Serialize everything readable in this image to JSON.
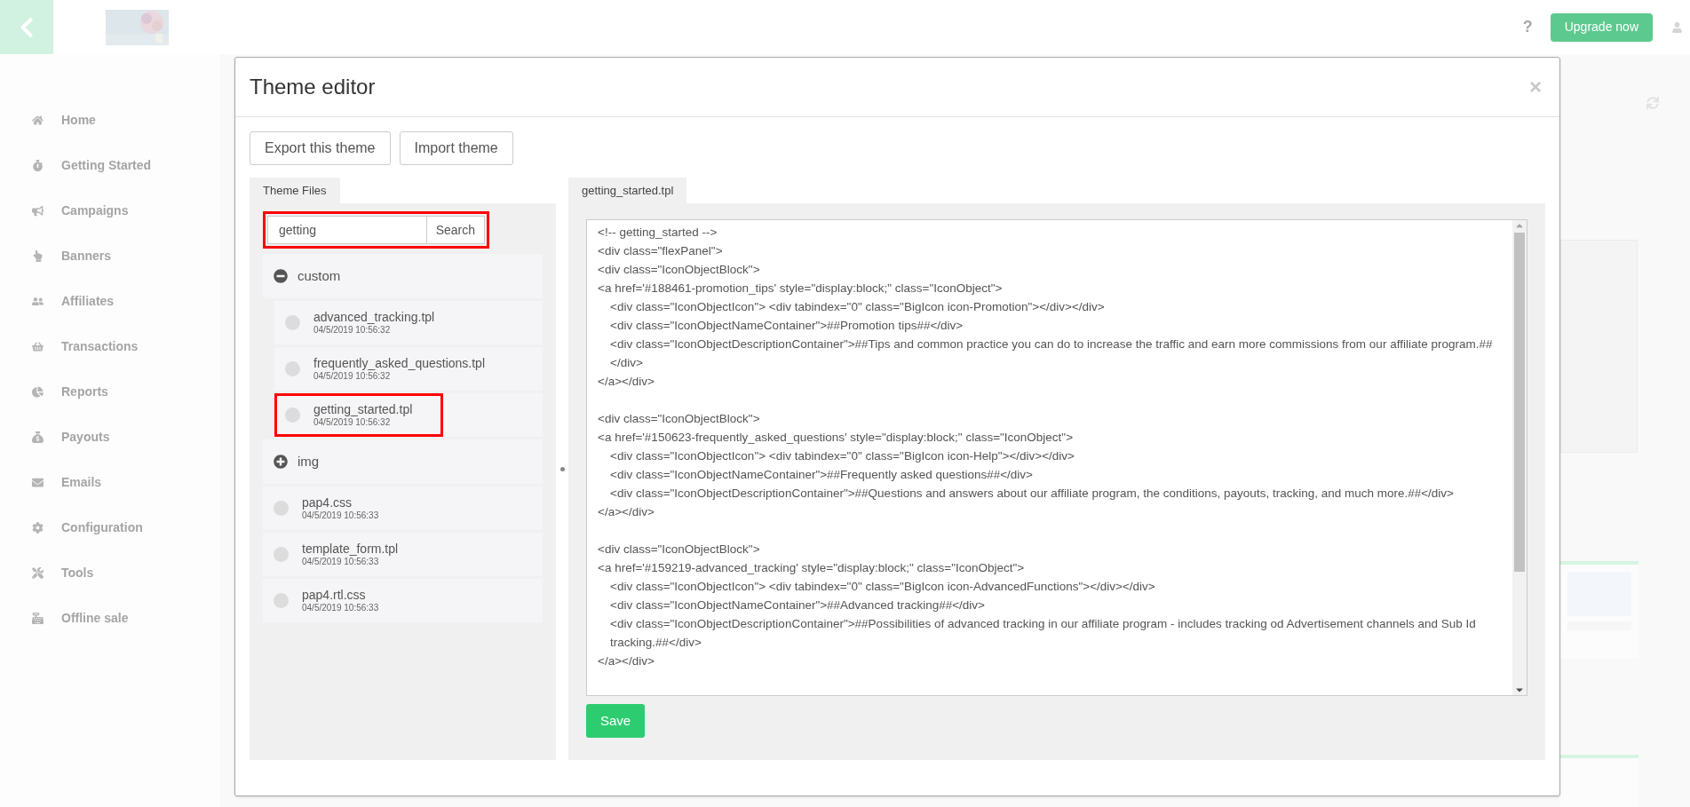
{
  "topbar": {
    "upgrade_button": "Upgrade now",
    "help": "?"
  },
  "sidebar": {
    "items": [
      "Home",
      "Getting Started",
      "Campaigns",
      "Banners",
      "Affiliates",
      "Transactions",
      "Reports",
      "Payouts",
      "Emails",
      "Configuration",
      "Tools",
      "Offline sale"
    ]
  },
  "dialog": {
    "title": "Theme editor",
    "close": "×",
    "buttons": [
      "Export this theme",
      "Import theme"
    ],
    "files_panel": {
      "tab": "Theme Files",
      "search": {
        "value": "getting",
        "button": "Search",
        "highlighted": true
      },
      "tree": [
        {
          "kind": "folder",
          "name": "custom",
          "expanded": true,
          "children": [
            {
              "kind": "file",
              "name": "advanced_tracking.tpl",
              "date": "04/5/2019 10:56:32",
              "highlighted": false,
              "selected": false
            },
            {
              "kind": "file",
              "name": "frequently_asked_questions.tpl",
              "date": "04/5/2019 10:56:32",
              "highlighted": false,
              "selected": false
            },
            {
              "kind": "file",
              "name": "getting_started.tpl",
              "date": "04/5/2019 10:56:32",
              "highlighted": true,
              "selected": false
            }
          ]
        },
        {
          "kind": "folder",
          "name": "img",
          "expanded": false
        },
        {
          "kind": "file",
          "name": "pap4.css",
          "date": "04/5/2019 10:56:33",
          "highlighted": false,
          "selected": false
        },
        {
          "kind": "file",
          "name": "template_form.tpl",
          "date": "04/5/2019 10:56:33",
          "highlighted": false,
          "selected": false
        },
        {
          "kind": "file",
          "name": "pap4.rtl.css",
          "date": "04/5/2019 10:56:33",
          "highlighted": false,
          "selected": false
        }
      ]
    },
    "editor": {
      "tab": "getting_started.tpl",
      "save_button": "Save",
      "blocks": [
        [
          {
            "text": "<!-- getting_started -->",
            "indented": false
          },
          {
            "text": "<div class=\"flexPanel\">",
            "indented": false
          },
          {
            "text": "<div class=\"IconObjectBlock\">",
            "indented": false
          },
          {
            "text": "<a href='#188461-promotion_tips' style=\"display:block;\" class=\"IconObject\">",
            "indented": false
          },
          {
            "text": "<div class=\"IconObjectIcon\"> <div tabindex=\"0\" class=\"BigIcon icon-Promotion\"></div></div>",
            "indented": true
          },
          {
            "text": "<div class=\"IconObjectNameContainer\">##Promotion tips##</div>",
            "indented": true
          },
          {
            "text": "<div class=\"IconObjectDescriptionContainer\">##Tips and common practice you can do to increase the traffic and earn more commissions from our affiliate program.##</div>",
            "indented": true
          },
          {
            "text": "</a></div>",
            "indented": false
          }
        ],
        [
          {
            "text": "<div class=\"IconObjectBlock\">",
            "indented": false
          },
          {
            "text": "<a href='#150623-frequently_asked_questions' style=\"display:block;\" class=\"IconObject\">",
            "indented": false
          },
          {
            "text": "<div class=\"IconObjectIcon\"> <div tabindex=\"0\" class=\"BigIcon icon-Help\"></div></div>",
            "indented": true
          },
          {
            "text": "<div class=\"IconObjectNameContainer\">##Frequently asked questions##</div>",
            "indented": true
          },
          {
            "text": "<div class=\"IconObjectDescriptionContainer\">##Questions and answers about our affiliate program, the conditions, payouts, tracking, and much more.##</div>",
            "indented": true
          },
          {
            "text": "</a></div>",
            "indented": false
          }
        ],
        [
          {
            "text": "<div class=\"IconObjectBlock\">",
            "indented": false
          },
          {
            "text": "<a href='#159219-advanced_tracking' style=\"display:block;\" class=\"IconObject\">",
            "indented": false
          },
          {
            "text": "<div class=\"IconObjectIcon\"> <div tabindex=\"0\" class=\"BigIcon icon-AdvancedFunctions\"></div></div>",
            "indented": true
          },
          {
            "text": "<div class=\"IconObjectNameContainer\">##Advanced tracking##</div>",
            "indented": true
          },
          {
            "text": "<div class=\"IconObjectDescriptionContainer\">##Possibilities of advanced tracking in our affiliate program - includes tracking od Advertisement channels and Sub Id tracking.##</div>",
            "indented": true
          },
          {
            "text": "</a></div>",
            "indented": false
          }
        ]
      ]
    }
  }
}
